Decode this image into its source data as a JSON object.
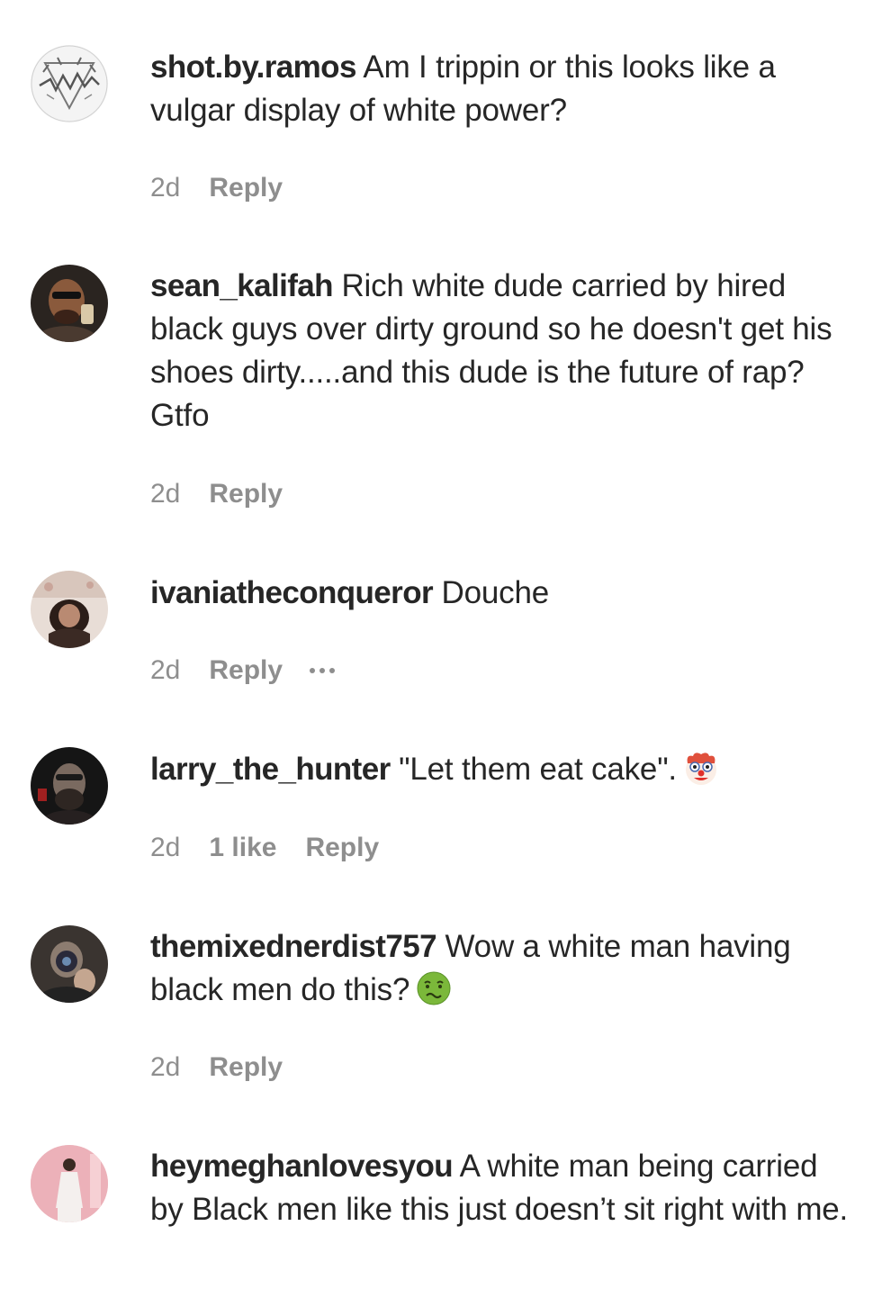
{
  "comments": [
    {
      "username": "shot.by.ramos",
      "text": "Am I trippin or this looks like a vulgar display of white power?",
      "time": "2d",
      "reply": "Reply",
      "avatar_icon": "band-logo-pentagram-avatar"
    },
    {
      "username": "sean_kalifah",
      "text": "Rich white dude carried by hired black guys over dirty ground so he doesn't get his shoes dirty.....and this dude is the future of rap? Gtfo",
      "time": "2d",
      "reply": "Reply",
      "avatar_icon": "profile-photo-avatar"
    },
    {
      "username": "ivaniatheconqueror",
      "text": "Douche",
      "time": "2d",
      "reply": "Reply",
      "avatar_icon": "profile-photo-avatar"
    },
    {
      "username": "larry_the_hunter",
      "text": "\"Let them eat cake\".",
      "emoji": "clown-face-emoji",
      "time": "2d",
      "likes": "1 like",
      "reply": "Reply",
      "avatar_icon": "profile-photo-avatar"
    },
    {
      "username": "themixednerdist757",
      "text": "Wow a white man having black men do this?",
      "emoji": "nauseated-face-emoji",
      "time": "2d",
      "reply": "Reply",
      "avatar_icon": "profile-photo-avatar"
    },
    {
      "username": "heymeghanlovesyou",
      "text": "A white man being carried by Black men like this just doesn’t sit right with me.",
      "avatar_icon": "profile-photo-avatar"
    }
  ]
}
